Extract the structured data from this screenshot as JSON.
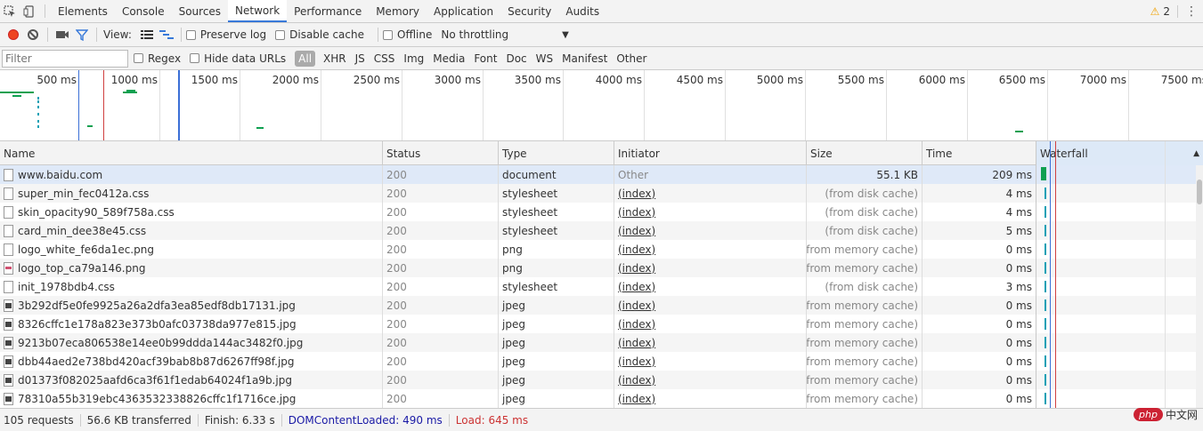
{
  "tabbar": {
    "icons": [
      "select-element-icon",
      "device-toolbar-icon"
    ],
    "tabs": [
      "Elements",
      "Console",
      "Sources",
      "Network",
      "Performance",
      "Memory",
      "Application",
      "Security",
      "Audits"
    ],
    "active_tab": "Network",
    "warning_count": "2",
    "warning_icon": "warning-triangle-icon",
    "menu_icon": "kebab-menu-icon"
  },
  "toolbar": {
    "record_icon": "record-icon",
    "clear_icon": "clear-icon",
    "capture_icon": "video-camera-icon",
    "filter_icon": "filter-icon",
    "view_label": "View:",
    "view_list_icon": "list-view-icon",
    "view_waterfall_icon": "waterfall-view-icon",
    "preserve_log": "Preserve log",
    "disable_cache": "Disable cache",
    "offline": "Offline",
    "throttling": "No throttling"
  },
  "filterbar": {
    "placeholder": "Filter",
    "regex": "Regex",
    "hide_data_urls": "Hide data URLs",
    "types": [
      "All",
      "XHR",
      "JS",
      "CSS",
      "Img",
      "Media",
      "Font",
      "Doc",
      "WS",
      "Manifest",
      "Other"
    ],
    "active_type": "All"
  },
  "overview": {
    "tick_labels": [
      "500 ms",
      "1000 ms",
      "1500 ms",
      "2000 ms",
      "2500 ms",
      "3000 ms",
      "3500 ms",
      "4000 ms",
      "4500 ms",
      "5000 ms",
      "5500 ms",
      "6000 ms",
      "6500 ms",
      "7000 ms",
      "7500 ms"
    ],
    "dom_content_loaded_color": "#3b6fd6",
    "load_color": "#d04040",
    "bar_color": "#0fa050"
  },
  "table": {
    "columns": [
      "Name",
      "Status",
      "Type",
      "Initiator",
      "Size",
      "Time",
      "Waterfall"
    ],
    "rows": [
      {
        "name": "www.baidu.com",
        "status": "200",
        "type": "document",
        "initiator": "Other",
        "size": "55.1 KB",
        "time": "209 ms",
        "icon": "document-icon"
      },
      {
        "name": "super_min_fec0412a.css",
        "status": "200",
        "type": "stylesheet",
        "initiator": "(index)",
        "size": "(from disk cache)",
        "time": "4 ms",
        "icon": "document-icon"
      },
      {
        "name": "skin_opacity90_589f758a.css",
        "status": "200",
        "type": "stylesheet",
        "initiator": "(index)",
        "size": "(from disk cache)",
        "time": "4 ms",
        "icon": "document-icon"
      },
      {
        "name": "card_min_dee38e45.css",
        "status": "200",
        "type": "stylesheet",
        "initiator": "(index)",
        "size": "(from disk cache)",
        "time": "5 ms",
        "icon": "document-icon"
      },
      {
        "name": "logo_white_fe6da1ec.png",
        "status": "200",
        "type": "png",
        "initiator": "(index)",
        "size": "(from memory cache)",
        "time": "0 ms",
        "icon": "document-icon"
      },
      {
        "name": "logo_top_ca79a146.png",
        "status": "200",
        "type": "png",
        "initiator": "(index)",
        "size": "(from memory cache)",
        "time": "0 ms",
        "icon": "png-thumbnail-icon"
      },
      {
        "name": "init_1978bdb4.css",
        "status": "200",
        "type": "stylesheet",
        "initiator": "(index)",
        "size": "(from disk cache)",
        "time": "3 ms",
        "icon": "document-icon"
      },
      {
        "name": "3b292df5e0fe9925a26a2dfa3ea85edf8db17131.jpg",
        "status": "200",
        "type": "jpeg",
        "initiator": "(index)",
        "size": "(from memory cache)",
        "time": "0 ms",
        "icon": "image-thumbnail-icon"
      },
      {
        "name": "8326cffc1e178a823e373b0afc03738da977e815.jpg",
        "status": "200",
        "type": "jpeg",
        "initiator": "(index)",
        "size": "(from memory cache)",
        "time": "0 ms",
        "icon": "image-thumbnail-icon"
      },
      {
        "name": "9213b07eca806538e14ee0b99ddda144ac3482f0.jpg",
        "status": "200",
        "type": "jpeg",
        "initiator": "(index)",
        "size": "(from memory cache)",
        "time": "0 ms",
        "icon": "image-thumbnail-icon"
      },
      {
        "name": "dbb44aed2e738bd420acf39bab8b87d6267ff98f.jpg",
        "status": "200",
        "type": "jpeg",
        "initiator": "(index)",
        "size": "(from memory cache)",
        "time": "0 ms",
        "icon": "image-thumbnail-icon"
      },
      {
        "name": "d01373f082025aafd6ca3f61f1edab64024f1a9b.jpg",
        "status": "200",
        "type": "jpeg",
        "initiator": "(index)",
        "size": "(from memory cache)",
        "time": "0 ms",
        "icon": "image-thumbnail-icon"
      },
      {
        "name": "78310a55b319ebc4363532338826cffc1f1716ce.jpg",
        "status": "200",
        "type": "jpeg",
        "initiator": "(index)",
        "size": "(from memory cache)",
        "time": "0 ms",
        "icon": "image-thumbnail-icon"
      }
    ]
  },
  "statusbar": {
    "requests": "105 requests",
    "transferred": "56.6 KB transferred",
    "finish": "Finish: 6.33 s",
    "dom_content_loaded": "DOMContentLoaded: 490 ms",
    "load": "Load: 645 ms"
  },
  "watermark": {
    "logo": "php",
    "text": "中文网"
  }
}
